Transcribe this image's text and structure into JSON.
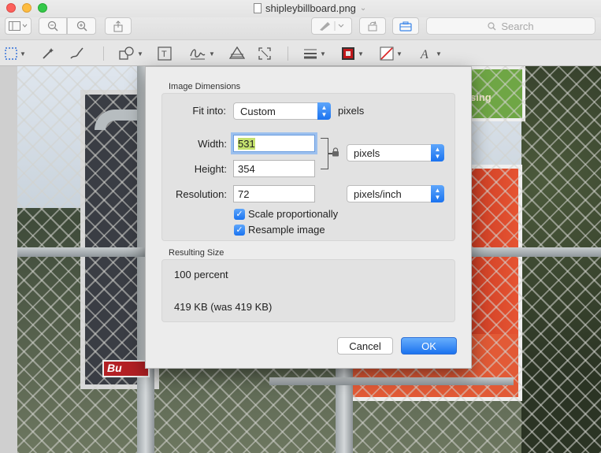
{
  "window": {
    "title": "shipleybillboard.png"
  },
  "toolbar": {
    "search_placeholder": "Search",
    "icons": [
      "sidebar-icon",
      "zoom-out-icon",
      "zoom-in-icon",
      "share-icon",
      "markup-pen-icon",
      "rotate-icon",
      "toolbox-icon"
    ]
  },
  "markup_tools": [
    "rect-select-icon",
    "instant-alpha-icon",
    "sketch-icon",
    "shapes-icon",
    "text-icon",
    "sign-icon",
    "adjust-color-icon",
    "adjust-size-icon",
    "line-style-icon",
    "border-color-icon",
    "fill-color-icon",
    "text-style-icon"
  ],
  "dialog": {
    "image_dimensions_title": "Image Dimensions",
    "fit_into_label": "Fit into:",
    "fit_into_value": "Custom",
    "fit_into_unit": "pixels",
    "width_label": "Width:",
    "width_value": "531",
    "height_label": "Height:",
    "height_value": "354",
    "size_unit": "pixels",
    "resolution_label": "Resolution:",
    "resolution_value": "72",
    "resolution_unit": "pixels/inch",
    "scale_proportionally_label": "Scale proportionally",
    "scale_proportionally_checked": true,
    "resample_label": "Resample image",
    "resample_checked": true,
    "resulting_size_title": "Resulting Size",
    "result_percent": "100 percent",
    "result_filesize": "419 KB (was 419 KB)",
    "cancel_label": "Cancel",
    "ok_label": "OK"
  },
  "photo": {
    "sign_text": "Bu",
    "billboard_text": "sing"
  },
  "colors": {
    "accent": "#1a73f0",
    "close": "#fc605c",
    "minimize": "#fdbc40",
    "zoom": "#34c84a",
    "selection": "#c5e26e"
  }
}
